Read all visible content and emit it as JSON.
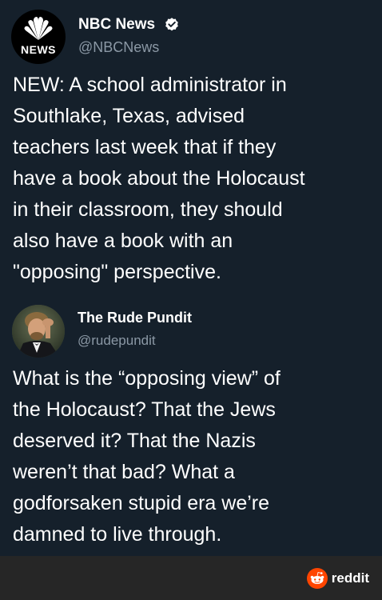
{
  "tweets": [
    {
      "author": {
        "name": "NBC News",
        "handle": "@NBCNews",
        "avatar_logo_text": "NEWS",
        "verified": true
      },
      "text": "NEW: A school administrator in\nSouthlake, Texas, advised\nteachers last week that if they\nhave a book about the Holocaust\nin their classroom, they should\nalso have a book with an\n\"opposing\" perspective."
    },
    {
      "author": {
        "name": "The Rude Pundit",
        "handle": "@rudepundit",
        "verified": false
      },
      "text": "What is the “opposing view” of\nthe Holocaust? That the Jews\ndeserved it? That the Nazis\nweren’t that bad? What a\ngodforsaken stupid era we’re\ndamned to live through."
    }
  ],
  "watermark": {
    "label": "reddit",
    "icon": "reddit-snoo-icon",
    "icon_color": "#ff4500"
  },
  "colors": {
    "background": "#15202b",
    "handle": "#8b98a5",
    "verified": "#ffffff",
    "footer": "#262626"
  }
}
